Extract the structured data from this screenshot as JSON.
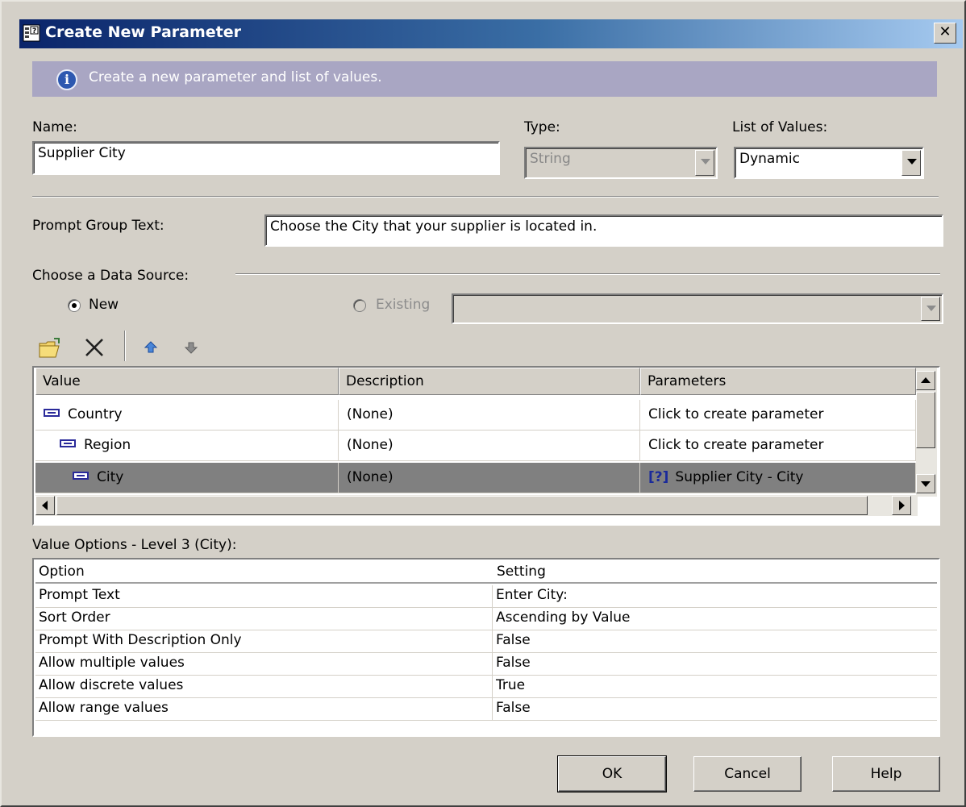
{
  "window": {
    "title": "Create New Parameter",
    "close_glyph": "✕"
  },
  "banner": {
    "text": "Create a new parameter and list of values.",
    "icon_glyph": "i"
  },
  "name_field": {
    "label": "Name:",
    "value": "Supplier City"
  },
  "type_field": {
    "label": "Type:",
    "value": "String"
  },
  "lov_field": {
    "label": "List of Values:",
    "value": "Dynamic"
  },
  "prompt_group": {
    "label": "Prompt Group Text:",
    "value": "Choose the City that your supplier is located in."
  },
  "data_source": {
    "label": "Choose a Data Source:",
    "new_label": "New",
    "existing_label": "Existing",
    "existing_value": "",
    "selected": "New"
  },
  "toolbar": {
    "icons": [
      "open-folder-icon",
      "delete-icon",
      "move-up-icon",
      "move-down-icon"
    ]
  },
  "value_grid": {
    "columns": [
      "Value",
      "Description",
      "Parameters"
    ],
    "rows": [
      {
        "value": "Country",
        "description": "(None)",
        "parameters": "Click to create parameter"
      },
      {
        "value": "Region",
        "description": "(None)",
        "parameters": "Click to create parameter"
      },
      {
        "value": "City",
        "description": "(None)",
        "parameters": "Supplier City - City",
        "param_glyph": "[?]"
      }
    ]
  },
  "value_options": {
    "label": "Value Options - Level 3 (City):",
    "columns": [
      "Option",
      "Setting"
    ],
    "rows": [
      {
        "option": "Prompt Text",
        "setting": "Enter City:"
      },
      {
        "option": "Sort Order",
        "setting": "Ascending by Value"
      },
      {
        "option": "Prompt With Description Only",
        "setting": "False"
      },
      {
        "option": "Allow multiple values",
        "setting": "False"
      },
      {
        "option": "Allow discrete values",
        "setting": "True"
      },
      {
        "option": "Allow range values",
        "setting": "False"
      }
    ]
  },
  "buttons": {
    "ok": "OK",
    "cancel": "Cancel",
    "help": "Help"
  },
  "colors": {
    "title_bar_start": "#0a246a",
    "banner": "#a9a6c3",
    "dialog_bg": "#d4d0c8",
    "selected_row": "#808080"
  }
}
